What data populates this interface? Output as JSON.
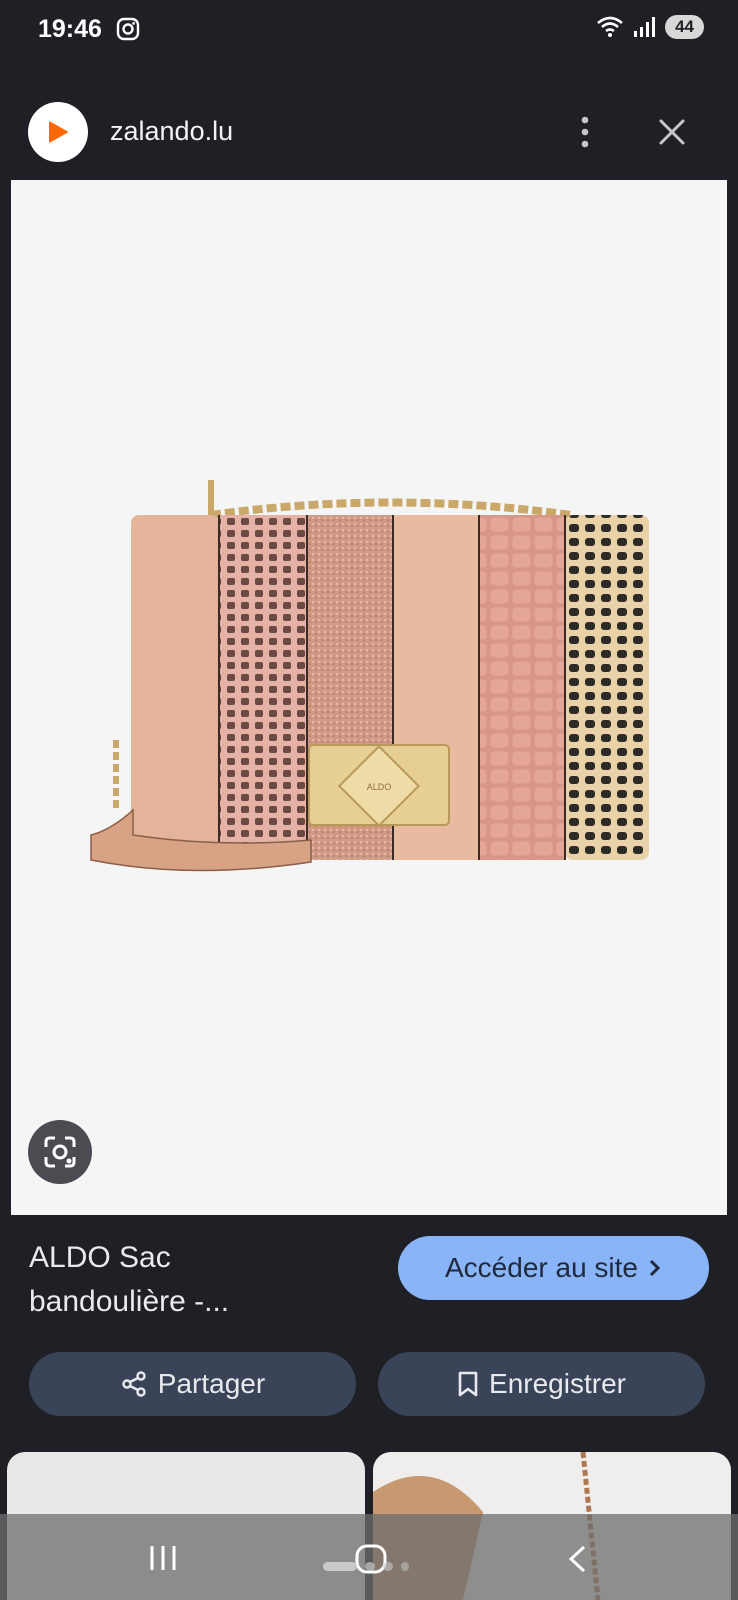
{
  "status_bar": {
    "time": "19:46",
    "battery": "44",
    "icons": [
      "instagram-icon",
      "wifi-icon",
      "signal-icon"
    ]
  },
  "header": {
    "domain": "zalando.lu",
    "favicon": "zalando-logo-icon"
  },
  "image": {
    "brand_mark": "ALDO"
  },
  "result": {
    "title_line1": "ALDO Sac",
    "title_line2": "bandoulière -...",
    "visit_label": "Accéder au site"
  },
  "actions": {
    "share_label": "Partager",
    "save_label": "Enregistrer"
  },
  "colors": {
    "background": "#1f2025",
    "accent": "#8ab4f8",
    "action_button": "#3a4458",
    "brand_orange": "#ff6900"
  }
}
